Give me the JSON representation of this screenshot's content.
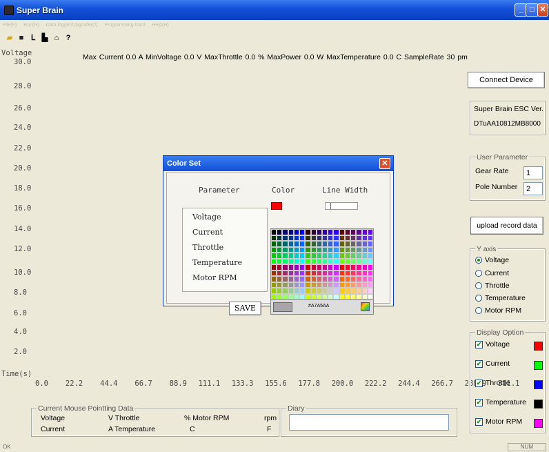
{
  "window": {
    "title": "Super Brain"
  },
  "menu": {
    "items": [
      "File(F)",
      "Run(R)",
      "Data logger/Upgrade(U)",
      "Programming Card",
      "Help(H)"
    ]
  },
  "toolbar": {
    "icons": [
      "open-icon",
      "save-icon",
      "chart-icon",
      "bar-icon",
      "upload-icon",
      "help-icon"
    ]
  },
  "stats": {
    "line": "Max Current 0.0   A MinVoltage  0.0   V MaxThrottle 0.0    % MaxPower 0.0     W MaxTemperature 0.0       C SampleRate 30  pm"
  },
  "plot": {
    "ylabel": "Voltage",
    "yticks": [
      "30.0",
      "28.0",
      "26.0",
      "24.0",
      "22.0",
      "20.0",
      "18.0",
      "16.0",
      "14.0",
      "12.0",
      "10.0",
      "8.0",
      "6.0",
      "4.0",
      "2.0"
    ],
    "xlabel": "Time(s)",
    "xticks": "0.0   22.2   44.4   66.7   88.9  111.1  133.3  155.6  177.8  200.0  222.2  244.4  266.7  288.9  311.1"
  },
  "right": {
    "connect_button": "Connect Device",
    "esc_group_title": "Super Brain ESC Ver.",
    "esc_version": "DTuAA10812MB8000",
    "user_param_title": "User Parameter",
    "gear_rate_label": "Gear Rate",
    "gear_rate_value": "1",
    "pole_number_label": "Pole Number",
    "pole_number_value": "2",
    "upload_button": "upload record data",
    "y_axis_title": "Y axis",
    "y_axis_options": [
      "Voltage",
      "Current",
      "Throttle",
      "Temperature",
      "Motor RPM"
    ],
    "y_axis_selected": "Voltage",
    "display_title": "Display Option",
    "display_options": [
      {
        "label": "Voltage",
        "checked": true,
        "color": "#ff0000"
      },
      {
        "label": "Current",
        "checked": true,
        "color": "#00ff00"
      },
      {
        "label": "Throttle",
        "checked": true,
        "color": "#0000ff"
      },
      {
        "label": "Temperature",
        "checked": true,
        "color": "#000000"
      },
      {
        "label": "Motor RPM",
        "checked": true,
        "color": "#ff00ff"
      }
    ]
  },
  "bottom": {
    "mouse_title": "Current Mouse Pointting Data",
    "row1": {
      "a": "Voltage",
      "b": "V  Throttle",
      "c": "%  Motor RPM",
      "d": "rpm"
    },
    "row2": {
      "a": "Current",
      "b": "A  Temperature",
      "c": "C",
      "d": "F"
    },
    "diary_title": "Diary"
  },
  "status": {
    "left": "OK",
    "right": "NUM"
  },
  "dialog": {
    "title": "Color Set",
    "headers": {
      "parameter": "Parameter",
      "color": "Color",
      "line_width": "Line Width"
    },
    "params": [
      "Voltage",
      "Current",
      "Throttle",
      "Temperature",
      "Motor RPM"
    ],
    "selected_color": "#ff0000",
    "save": "SAVE",
    "hex": "#A7A5AA"
  }
}
